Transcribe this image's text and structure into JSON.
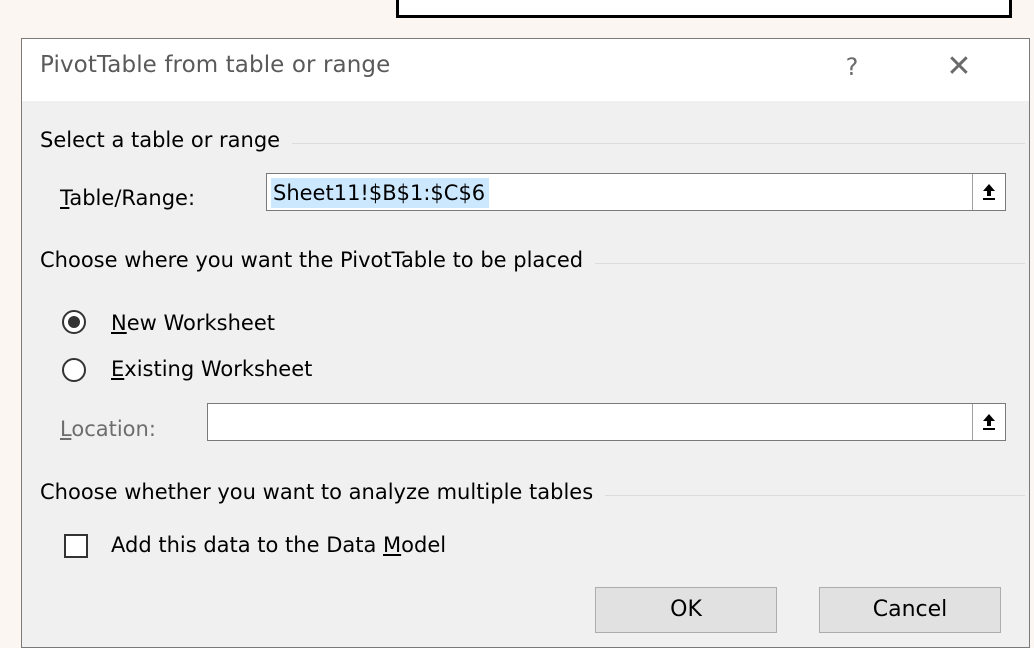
{
  "dialog": {
    "title": "PivotTable from table or range",
    "help_label": "?",
    "close_label": "✕"
  },
  "section_table": {
    "heading": "Select a table or range",
    "range_label_mnemonic": "T",
    "range_label_rest": "able/Range:",
    "range_value": "Sheet11!$B$1:$C$6"
  },
  "section_placement": {
    "heading": "Choose where you want the PivotTable to be placed",
    "options": [
      {
        "mnemonic": "N",
        "rest": "ew Worksheet",
        "selected": true
      },
      {
        "mnemonic": "E",
        "rest": "xisting Worksheet",
        "selected": false
      }
    ],
    "location_label_mnemonic": "L",
    "location_label_rest": "ocation:",
    "location_value": ""
  },
  "section_multiple": {
    "heading": "Choose whether you want to analyze multiple tables",
    "checkbox_label_prefix": "Add this data to the Data ",
    "checkbox_label_mnemonic": "M",
    "checkbox_label_suffix": "odel",
    "checked": false
  },
  "buttons": {
    "ok": "OK",
    "cancel": "Cancel"
  },
  "icons": {
    "collapse": "collapse-dialog-arrow-up-icon"
  },
  "colors": {
    "dialog_bg": "#f0f0f0",
    "selection_highlight": "#cce8ff",
    "page_bg": "#fbf6f1"
  }
}
